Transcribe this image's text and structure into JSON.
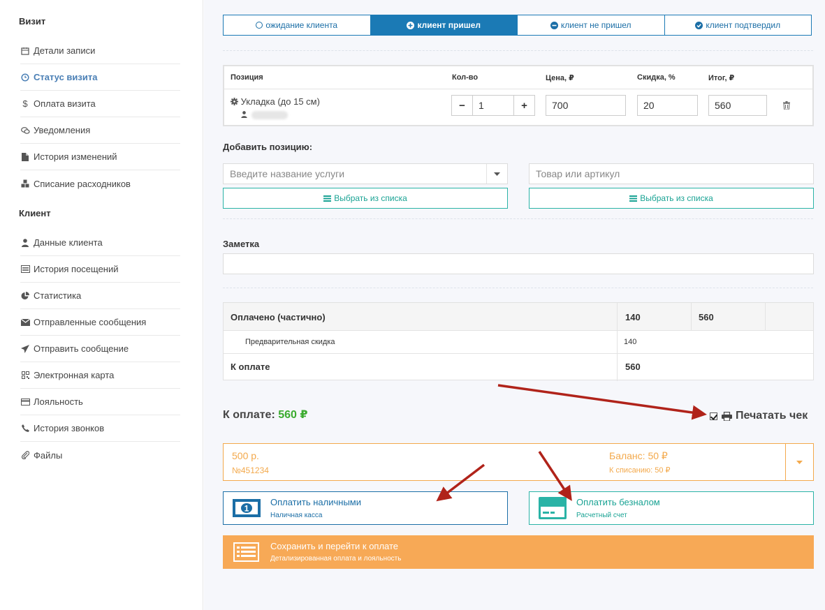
{
  "sidebar": {
    "visit_section": "Визит",
    "client_section": "Клиент",
    "visit_items": [
      {
        "label": "Детали записи",
        "icon": "calendar-icon"
      },
      {
        "label": "Статус визита",
        "icon": "clock-icon",
        "active": true
      },
      {
        "label": "Оплата визита",
        "icon": "dollar-icon"
      },
      {
        "label": "Уведомления",
        "icon": "chat-icon"
      },
      {
        "label": "История изменений",
        "icon": "document-icon"
      },
      {
        "label": "Списание расходников",
        "icon": "cubes-icon"
      }
    ],
    "client_items": [
      {
        "label": "Данные клиента",
        "icon": "user-icon"
      },
      {
        "label": "История посещений",
        "icon": "list-icon"
      },
      {
        "label": "Статистика",
        "icon": "pie-chart-icon"
      },
      {
        "label": "Отправленные сообщения",
        "icon": "envelope-icon"
      },
      {
        "label": "Отправить сообщение",
        "icon": "send-icon"
      },
      {
        "label": "Электронная карта",
        "icon": "qr-icon"
      },
      {
        "label": "Лояльность",
        "icon": "credit-card-icon"
      },
      {
        "label": "История звонков",
        "icon": "phone-icon"
      },
      {
        "label": "Файлы",
        "icon": "paperclip-icon"
      }
    ]
  },
  "status_tabs": [
    {
      "label": "ожидание клиента",
      "icon": "clock-icon"
    },
    {
      "label": "клиент пришел",
      "icon": "plus-circle-icon",
      "active": true
    },
    {
      "label": "клиент не пришел",
      "icon": "minus-circle-icon"
    },
    {
      "label": "клиент подтвердил",
      "icon": "check-circle-icon"
    }
  ],
  "positions_table": {
    "headers": {
      "position": "Позиция",
      "qty": "Кол-во",
      "price": "Цена, ₽",
      "discount": "Скидка, %",
      "total": "Итог, ₽"
    },
    "rows": [
      {
        "name": "Укладка (до 15 см)",
        "qty": "1",
        "price": "700",
        "discount": "20",
        "total": "560"
      }
    ]
  },
  "add_position": {
    "label": "Добавить позицию:",
    "service_placeholder": "Введите название услуги",
    "product_placeholder": "Товар или артикул",
    "choose_from_list": "Выбрать из списка"
  },
  "note": {
    "label": "Заметка",
    "value": ""
  },
  "summary": {
    "paid_label": "Оплачено (частично)",
    "paid_col1": "140",
    "paid_col2": "560",
    "discount_label": "Предварительная скидка",
    "discount_value": "140",
    "due_label": "К оплате",
    "due_value": "560"
  },
  "to_pay": {
    "label": "К оплате:",
    "amount": "560 ₽"
  },
  "print_receipt": {
    "label": "Печатать чек",
    "checked": true
  },
  "certificate": {
    "amount": "500 р.",
    "number": "№451234",
    "balance": "Баланс: 50 ₽",
    "write_off": "К списанию: 50 ₽"
  },
  "pay_cash": {
    "title": "Оплатить наличными",
    "subtitle": "Наличная касса"
  },
  "pay_card": {
    "title": "Оплатить безналом",
    "subtitle": "Расчетный счет"
  },
  "save_pay": {
    "title": "Сохранить и перейти к оплате",
    "subtitle": "Детализированная оплата и лояльность"
  },
  "colors": {
    "primary": "#1b7ab5",
    "teal": "#2ab3a6",
    "orange": "#f7a956",
    "green": "#3bab2f",
    "arrow": "#b0231a"
  }
}
